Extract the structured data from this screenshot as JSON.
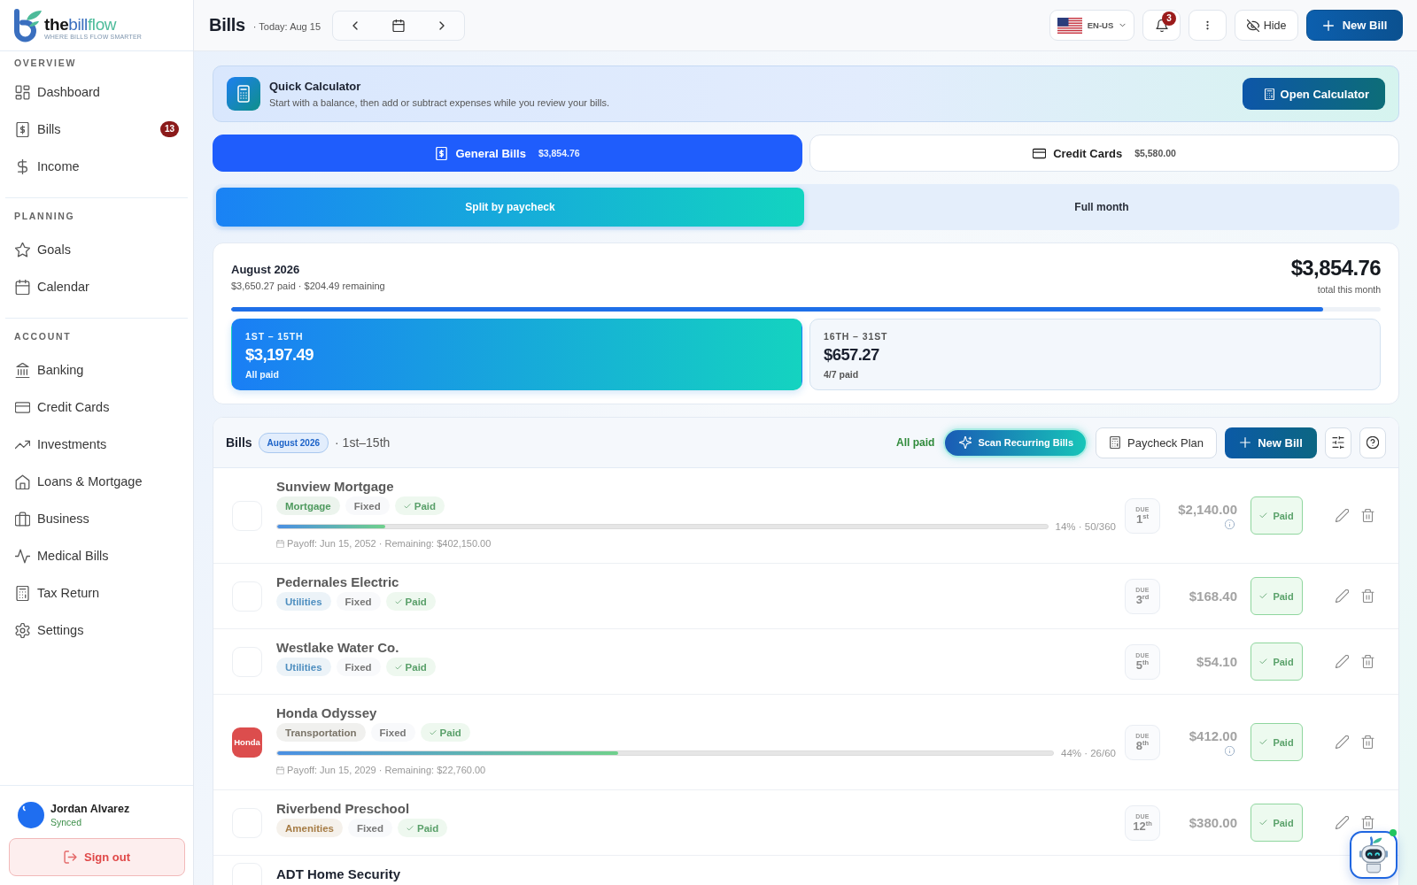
{
  "sidebar": {
    "logo": {
      "wordmark": [
        "the",
        "bill",
        "flow"
      ],
      "tagline": "WHERE BILLS FLOW SMARTER"
    },
    "sections": [
      {
        "title": "OVERVIEW",
        "items": [
          {
            "label": "Dashboard"
          },
          {
            "label": "Bills",
            "badge": "13"
          },
          {
            "label": "Income"
          }
        ]
      },
      {
        "title": "PLANNING",
        "items": [
          {
            "label": "Goals"
          },
          {
            "label": "Calendar"
          }
        ]
      },
      {
        "title": "ACCOUNT",
        "items": [
          {
            "label": "Banking"
          },
          {
            "label": "Credit Cards"
          },
          {
            "label": "Investments"
          },
          {
            "label": "Loans & Mortgage"
          },
          {
            "label": "Business"
          },
          {
            "label": "Medical Bills"
          },
          {
            "label": "Tax Return"
          },
          {
            "label": "Settings"
          }
        ]
      }
    ],
    "user": {
      "name": "Jordan Alvarez",
      "status": "Synced"
    },
    "sign_out": "Sign out"
  },
  "header": {
    "title": "Bills",
    "today": "· Today: Aug 15",
    "locale": "EN-US",
    "notifications": "3",
    "hide": "Hide",
    "new_bill": "New Bill"
  },
  "quick_calculator": {
    "title": "Quick Calculator",
    "description": "Start with a balance, then add or subtract expenses while you review your bills.",
    "button": "Open Calculator"
  },
  "tabs": [
    {
      "label": "General Bills",
      "amount": "$3,854.76",
      "selected": true
    },
    {
      "label": "Credit Cards",
      "amount": "$5,580.00",
      "selected": false
    }
  ],
  "view_modes": [
    {
      "label": "Split by paycheck",
      "selected": true
    },
    {
      "label": "Full month",
      "selected": false
    }
  ],
  "summary": {
    "month": "August 2026",
    "detail": "$3,650.27 paid · $204.49 remaining",
    "total": "$3,854.76",
    "total_label": "total this month",
    "level": 0.95,
    "periods": [
      {
        "range": "1ST – 15TH",
        "amount": "$3,197.49",
        "status": "All paid",
        "selected": true
      },
      {
        "range": "16TH – 31ST",
        "amount": "$657.27",
        "status": "4/7 paid",
        "selected": false
      }
    ]
  },
  "bills": {
    "title": "Bills",
    "month": "August 2026",
    "range": "· 1st–15th",
    "status": "All paid",
    "actions": [
      {
        "kind": "scan",
        "label": "Scan Recurring Bills"
      },
      {
        "kind": "plan",
        "label": "Paycheck Plan"
      },
      {
        "kind": "new",
        "label": "New Bill"
      }
    ],
    "rows": [
      {
        "name": "Sunview Mortgage",
        "category": {
          "label": "Mortgage",
          "color": "#4e9a5e"
        },
        "frequency": "Fixed",
        "status": "Paid",
        "progress": {
          "level": 0.14,
          "reading": "14% · 50/360",
          "payoff": "Payoff: Jun 15, 2052 · Remaining: $402,150.00"
        },
        "due_label": "DUE",
        "due": "1$^{st}$",
        "amount": "$2,140.00",
        "info": true,
        "paid": true,
        "action": "Paid"
      },
      {
        "name": "Pedernales Electric",
        "category": {
          "label": "Utilities",
          "color": "#4f8fc0"
        },
        "frequency": "Fixed",
        "status": "Paid",
        "due_label": "DUE",
        "due": "3$^{rd}$",
        "amount": "$168.40",
        "info": false,
        "paid": true,
        "action": "Paid"
      },
      {
        "name": "Westlake Water Co.",
        "category": {
          "label": "Utilities",
          "color": "#4f8fc0"
        },
        "frequency": "Fixed",
        "status": "Paid",
        "due_label": "DUE",
        "due": "5$^{th}$",
        "amount": "$54.10",
        "info": false,
        "paid": true,
        "action": "Paid"
      },
      {
        "name": "Honda Odyssey",
        "logo": {
          "text": "Honda",
          "color": "#dc4d4d"
        },
        "category": {
          "label": "Transportation",
          "color": "#7a7468"
        },
        "frequency": "Fixed",
        "status": "Paid",
        "progress": {
          "level": 0.44,
          "reading": "44% · 26/60",
          "payoff": "Payoff: Jun 15, 2029 · Remaining: $22,760.00"
        },
        "due_label": "DUE",
        "due": "8$^{th}$",
        "amount": "$412.00",
        "info": true,
        "paid": true,
        "action": "Paid"
      },
      {
        "name": "Riverbend Preschool",
        "category": {
          "label": "Amenities",
          "color": "#a67c45"
        },
        "frequency": "Fixed",
        "status": "Paid",
        "due_label": "DUE",
        "due": "12$^{th}$",
        "amount": "$380.00",
        "info": false,
        "paid": true,
        "action": "Paid"
      },
      {
        "name": "ADT Home Security"
      }
    ]
  }
}
